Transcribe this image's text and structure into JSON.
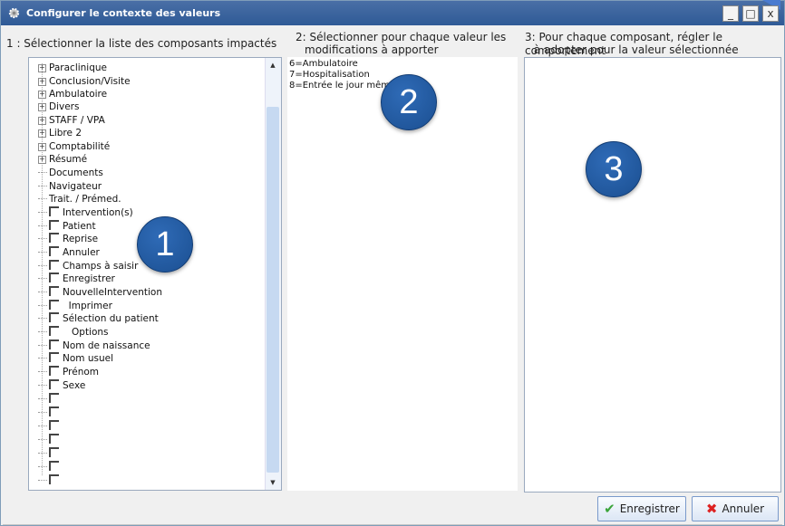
{
  "window": {
    "title": "Configurer le contexte des valeurs",
    "controls": {
      "minimize": "_",
      "maximize": "□",
      "close": "x"
    }
  },
  "columns": {
    "col1_header": "1 : Sélectionner la liste des composants impactés",
    "col2_header_line1": "2: Sélectionner pour chaque valeur les",
    "col2_header_line2": "modifications à apporter",
    "col3_header_line1": "3: Pour chaque composant, régler le comportement",
    "col3_header_line2": "à adopter pour la valeur sélectionnée"
  },
  "tree_groups": [
    "Paraclinique",
    "Conclusion/Visite",
    "Ambulatoire",
    "Divers",
    "STAFF  / VPA",
    "Libre 2",
    "Comptabilité",
    "Résumé"
  ],
  "tree_leaves": [
    "Documents",
    "Navigateur",
    "Trait. / Prémed."
  ],
  "tree_checkboxes": [
    "Intervention(s)",
    "Patient",
    "Reprise",
    "Annuler",
    "Champs à saisir",
    "Enregistrer",
    "NouvelleIntervention",
    "  Imprimer",
    "Sélection du patient",
    "   Options",
    "Nom de naissance",
    "Nom usuel",
    "Prénom",
    "Sexe",
    "",
    "",
    "",
    "",
    "",
    "",
    ""
  ],
  "values_list": [
    "6=Ambulatoire",
    "7=Hospitalisation",
    "8=Entrée le jour même"
  ],
  "badges": {
    "one": "1",
    "two": "2",
    "three": "3"
  },
  "buttons": {
    "save": "Enregistrer",
    "cancel": "Annuler"
  },
  "colors": {
    "title_bar": "#2f5a96",
    "badge": "#1f5ba5",
    "scroll_thumb": "#c6d9f1"
  }
}
